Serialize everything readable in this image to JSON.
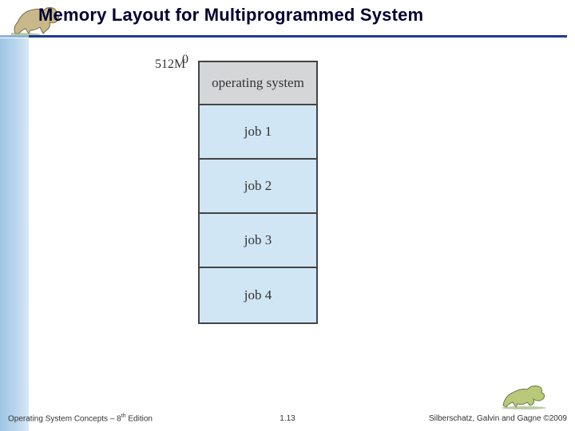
{
  "title": "Memory Layout for Multiprogrammed System",
  "memory": {
    "top_label": "0",
    "bottom_label": "512M",
    "rows": [
      {
        "label": "operating system",
        "class": "os"
      },
      {
        "label": "job 1",
        "class": "job"
      },
      {
        "label": "job 2",
        "class": "job"
      },
      {
        "label": "job 3",
        "class": "job"
      },
      {
        "label": "job 4",
        "class": "job"
      }
    ]
  },
  "footer": {
    "left_a": "Operating System Concepts – 8",
    "left_sup": "th",
    "left_b": " Edition",
    "center": "1.13",
    "right": "Silberschatz, Galvin and Gagne ©2009"
  },
  "icons": {
    "dino_top": "dinosaur-icon",
    "dino_bottom": "dinosaur-icon"
  }
}
